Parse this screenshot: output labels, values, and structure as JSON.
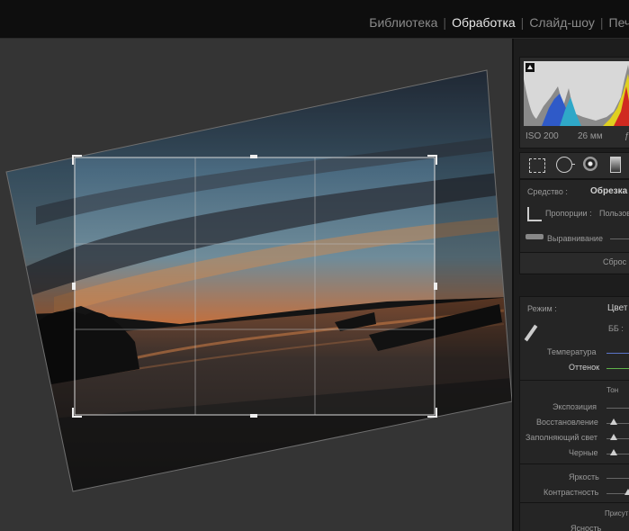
{
  "modules": [
    "Библиотека",
    "Обработка",
    "Слайд-шоу",
    "Печа"
  ],
  "active_module": "Обработка",
  "histogram": {
    "iso": "ISO 200",
    "focal": "26 мм",
    "aperture": "ƒ"
  },
  "crop_tool": {
    "tool_label": "Средство :",
    "tool_value": "Обрезка",
    "aspect_label": "Пропорции :",
    "aspect_value": "Пользов",
    "straighten_label": "Выравнивание",
    "reset_label": "Сброс"
  },
  "basic": {
    "mode_label": "Режим :",
    "mode_value": "Цвет",
    "wb_label": "ББ :",
    "temperature_label": "Температура",
    "tint_label": "Оттенок",
    "tone_header": "Тон",
    "exposure_label": "Экспозиция",
    "recovery_label": "Восстановление",
    "fill_light_label": "Заполняющий свет",
    "blacks_label": "Черные",
    "brightness_label": "Яркость",
    "contrast_label": "Контрастность",
    "presence_header": "Присут",
    "clarity_label": "Ясность"
  },
  "colors": {
    "topbar": "#0e0e0e",
    "canvas": "#484848",
    "panel": "#1d1d1d",
    "temperature_track": "#5b74c9",
    "tint_track": "#5fb24b"
  }
}
